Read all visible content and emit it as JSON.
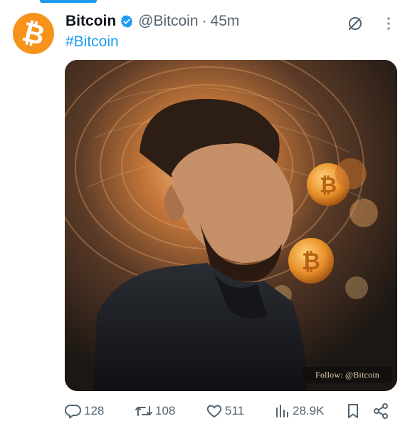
{
  "tweet": {
    "author": {
      "display_name": "Bitcoin",
      "handle": "@Bitcoin",
      "verified": true,
      "avatar_color": "#f7931a"
    },
    "separator": "·",
    "time": "45m",
    "text": "#Bitcoin",
    "media": {
      "watermark": "Follow: @Bitcoin"
    },
    "actions": {
      "replies": "128",
      "retweets": "108",
      "likes": "511",
      "views": "28.9K"
    }
  },
  "colors": {
    "accent": "#1d9bf0",
    "muted": "#536471",
    "bitcoin_orange": "#f7931a"
  },
  "icons": [
    "bitcoin-logo",
    "verified-badge-icon",
    "grok-icon",
    "more-vertical-icon",
    "reply-icon",
    "retweet-icon",
    "like-icon",
    "views-icon",
    "bookmark-icon",
    "share-icon"
  ]
}
